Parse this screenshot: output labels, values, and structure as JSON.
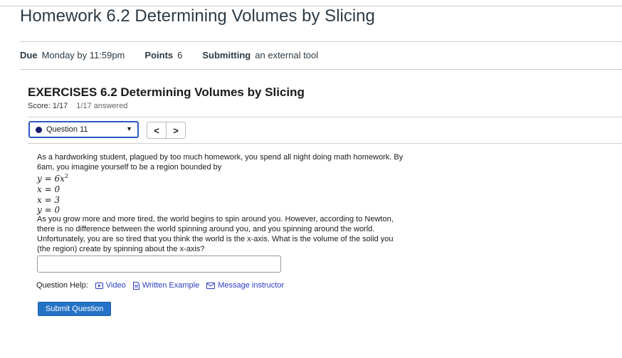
{
  "page_title": "Homework 6.2 Determining Volumes by Slicing",
  "meta": {
    "due_label": "Due",
    "due_value": "Monday by 11:59pm",
    "points_label": "Points",
    "points_value": "6",
    "submitting_label": "Submitting",
    "submitting_value": "an external tool"
  },
  "exercise": {
    "title": "EXERCISES 6.2 Determining Volumes by Slicing",
    "score": "Score: 1/17",
    "answered": "1/17 answered"
  },
  "question_selector": {
    "selected": "Question 11",
    "prev": "<",
    "next": ">"
  },
  "question": {
    "intro_line1": "As a hardworking student, plagued by too much homework, you spend all night doing math homework. By",
    "intro_line2": "6am, you imagine yourself to be a region bounded by",
    "equations": [
      "y = 6x",
      "x = 0",
      "x = 3",
      "y = 0"
    ],
    "eq1_exponent": "2",
    "body_line1": "As you grow more and more tired, the world begins to spin around you. However, according to Newton,",
    "body_line2": "there is no difference between the world spinning around you, and you spinning around the world.",
    "body_line3": "Unfortunately, you are so tired that you think the world is the x-axis. What is the volume of the solid you",
    "body_line4": "(the region) create by spinning about the x-axis?"
  },
  "help": {
    "label": "Question Help:",
    "video": "Video",
    "written_example": "Written Example",
    "message_instructor": "Message instructor"
  },
  "submit_label": "Submit Question",
  "colors": {
    "accent_blue": "#2573c7",
    "link_blue": "#2b3dc4",
    "select_border": "#2b59c3"
  }
}
